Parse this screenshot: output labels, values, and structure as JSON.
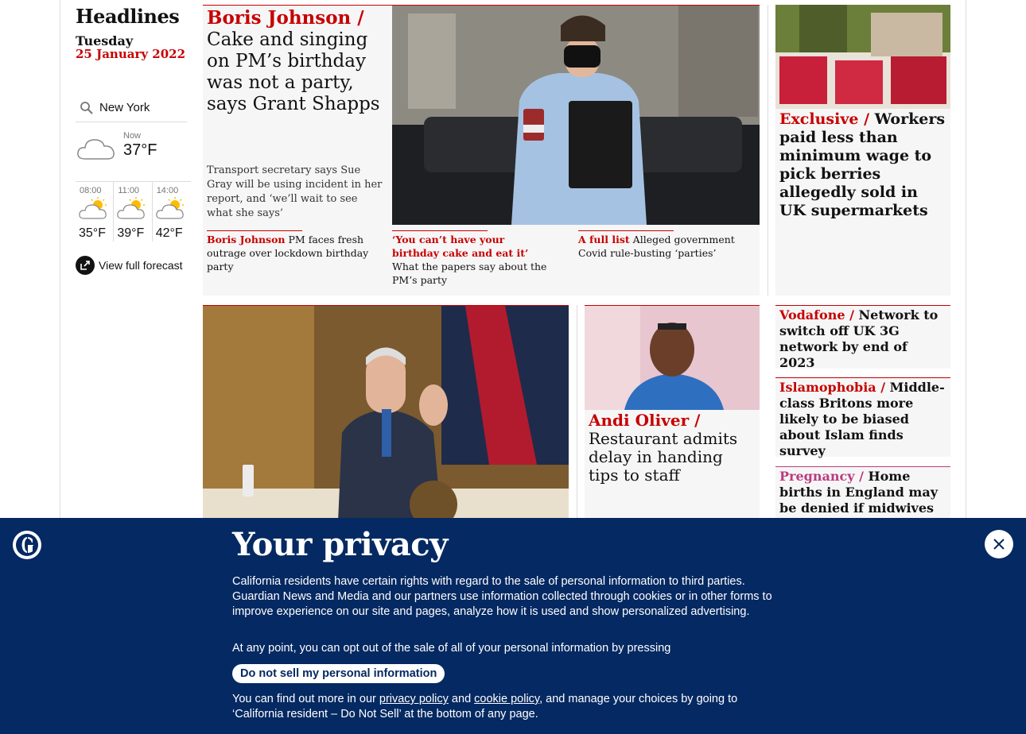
{
  "headlines": {
    "title": "Headlines",
    "day": "Tuesday",
    "date": "25 January 2022"
  },
  "weather": {
    "location": "New York",
    "now_label": "Now",
    "now_temp": "37°F",
    "forecast": [
      {
        "time": "08:00",
        "temp": "35°F"
      },
      {
        "time": "11:00",
        "temp": "39°F"
      },
      {
        "time": "14:00",
        "temp": "42°F"
      }
    ],
    "view_full": "View full forecast",
    "icons": [
      "search-icon",
      "cloud-icon",
      "sun-cloud-icon",
      "external-link-icon"
    ]
  },
  "main_story": {
    "kicker": "Boris Johnson /",
    "headline": "Cake and singing on PM’s birthday was not a party, says Grant Shapps",
    "trail": "Transport secretary says Sue Gray will be using incident in her report, and ‘we’ll wait to see what she says’",
    "sublinks": [
      {
        "kicker": "Boris Johnson",
        "text": "PM faces fresh outrage over lockdown birthday party"
      },
      {
        "kicker": "‘You can’t have your birthday cake and eat it’",
        "text": "What the papers say about the PM’s party"
      },
      {
        "kicker": "A full list",
        "text": "Alleged government Covid rule-busting ‘parties’"
      }
    ]
  },
  "right_top": {
    "kicker": "Exclusive /",
    "headline": "Workers paid less than minimum wage to pick berries allegedly sold in UK supermarkets"
  },
  "andi": {
    "kicker": "Andi Oliver /",
    "headline": "Restaurant admits delay in handing tips to staff"
  },
  "side_items": [
    {
      "kicker": "Vodafone /",
      "headline": "Network to switch off UK 3G network by end of 2023"
    },
    {
      "kicker": "Islamophobia /",
      "headline": "Middle-class Britons more likely to be biased about Islam finds survey"
    },
    {
      "kicker": "Pregnancy /",
      "headline": "Home births in England may be denied if midwives without Covid"
    }
  ],
  "privacy": {
    "title": "Your privacy",
    "body": "California residents have certain rights with regard to the sale of personal information to third parties. Guardian News and Media and our partners use information collected through cookies or in other forms to improve experience on our site and pages, analyze how it is used and show personalized advertising.",
    "body2": "At any point, you can opt out of the sale of all of your personal information by pressing",
    "button": "Do not sell my personal information",
    "body3_pre": "You can find out more in our ",
    "privacy_link": "privacy policy",
    "body3_and": " and ",
    "cookie_link": "cookie policy",
    "body3_post": ", and manage your choices by going to ‘California resident – Do Not Sell’ at the bottom of any page."
  },
  "colors": {
    "news_red": "#c70000",
    "pregnancy_pink": "#bb3b80",
    "banner_blue": "#052962"
  }
}
